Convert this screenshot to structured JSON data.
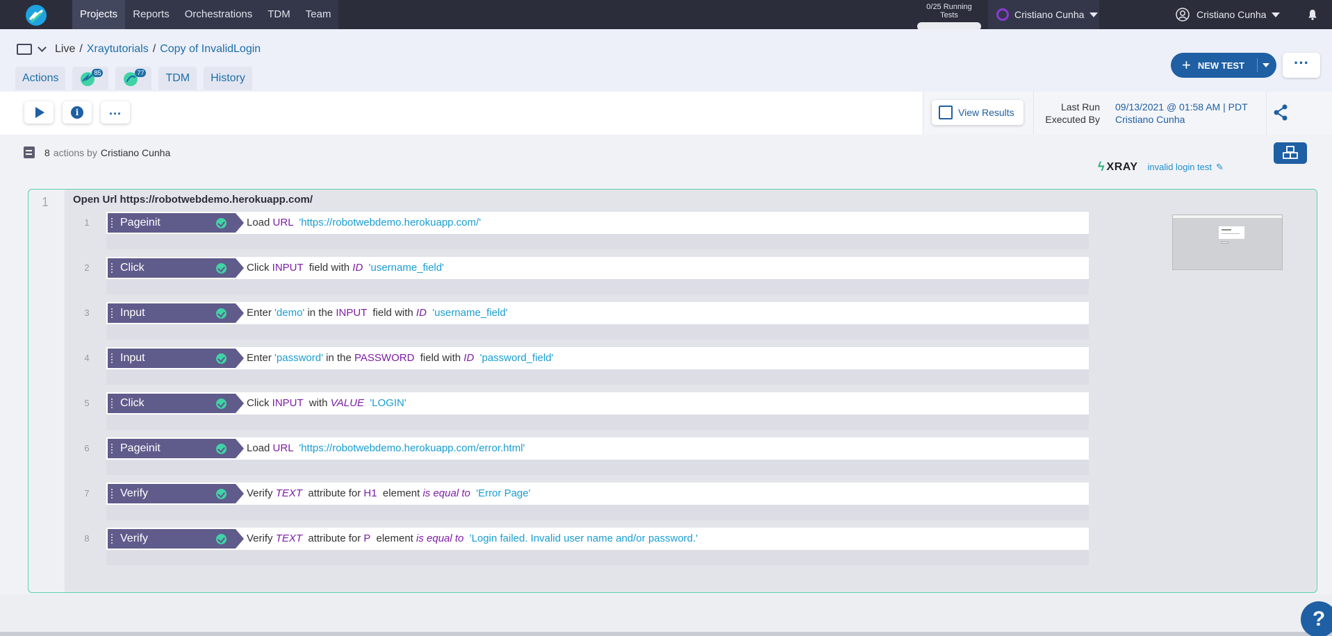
{
  "nav": {
    "items": [
      "Projects",
      "Reports",
      "Orchestrations",
      "TDM",
      "Team"
    ],
    "running_tests": "0/25 Running Tests",
    "org_user": "Cristiano Cunha",
    "account_user": "Cristiano Cunha"
  },
  "breadcrumb": {
    "root": "Live",
    "project": "Xraytutorials",
    "test": "Copy of InvalidLogin"
  },
  "tabs": {
    "actions": "Actions",
    "badge1": "85",
    "badge2": "77",
    "tdm": "TDM",
    "history": "History"
  },
  "header": {
    "new_test": "NEW TEST"
  },
  "run": {
    "view_results": "View Results",
    "last_run_label": "Last Run",
    "executed_by_label": "Executed By",
    "last_run_value": "09/13/2021 @ 01:58 AM | PDT",
    "executed_by_value": "Cristiano Cunha"
  },
  "summary": {
    "count": "8",
    "by_text": "actions by",
    "author": "Cristiano Cunha"
  },
  "xray": {
    "brand": "XRAY",
    "test_name": "invalid login test"
  },
  "panel": {
    "index": "1",
    "title": "Open Url https://robotwebdemo.herokuapp.com/"
  },
  "steps": [
    {
      "n": "1",
      "kw": "Pageinit",
      "desc": [
        [
          "t",
          "Load "
        ],
        [
          "p",
          "URL"
        ],
        [
          "t",
          "  "
        ],
        [
          "v",
          "'https://robotwebdemo.herokuapp.com/'"
        ]
      ]
    },
    {
      "n": "2",
      "kw": "Click",
      "desc": [
        [
          "t",
          "Click "
        ],
        [
          "p",
          "INPUT"
        ],
        [
          "t",
          "  field with "
        ],
        [
          "pi",
          "ID"
        ],
        [
          "t",
          "  "
        ],
        [
          "v",
          "'username_field'"
        ]
      ]
    },
    {
      "n": "3",
      "kw": "Input",
      "desc": [
        [
          "t",
          "Enter "
        ],
        [
          "v",
          "'demo'"
        ],
        [
          "t",
          " in the "
        ],
        [
          "p",
          "INPUT"
        ],
        [
          "t",
          "  field with "
        ],
        [
          "pi",
          "ID"
        ],
        [
          "t",
          "  "
        ],
        [
          "v",
          "'username_field'"
        ]
      ]
    },
    {
      "n": "4",
      "kw": "Input",
      "desc": [
        [
          "t",
          "Enter "
        ],
        [
          "v",
          "'password'"
        ],
        [
          "t",
          " in the "
        ],
        [
          "p",
          "PASSWORD"
        ],
        [
          "t",
          "  field with "
        ],
        [
          "pi",
          "ID"
        ],
        [
          "t",
          "  "
        ],
        [
          "v",
          "'password_field'"
        ]
      ]
    },
    {
      "n": "5",
      "kw": "Click",
      "desc": [
        [
          "t",
          "Click "
        ],
        [
          "p",
          "INPUT"
        ],
        [
          "t",
          "  with "
        ],
        [
          "pi",
          "VALUE"
        ],
        [
          "t",
          "  "
        ],
        [
          "v",
          "'LOGIN'"
        ]
      ]
    },
    {
      "n": "6",
      "kw": "Pageinit",
      "desc": [
        [
          "t",
          "Load "
        ],
        [
          "p",
          "URL"
        ],
        [
          "t",
          "  "
        ],
        [
          "v",
          "'https://robotwebdemo.herokuapp.com/error.html'"
        ]
      ]
    },
    {
      "n": "7",
      "kw": "Verify",
      "desc": [
        [
          "t",
          "Verify "
        ],
        [
          "pi",
          "TEXT"
        ],
        [
          "t",
          "  attribute for "
        ],
        [
          "p",
          "H1"
        ],
        [
          "t",
          "  element "
        ],
        [
          "pi",
          "is equal to"
        ],
        [
          "t",
          "  "
        ],
        [
          "v",
          "'Error Page'"
        ]
      ]
    },
    {
      "n": "8",
      "kw": "Verify",
      "desc": [
        [
          "t",
          "Verify "
        ],
        [
          "pi",
          "TEXT"
        ],
        [
          "t",
          "  attribute for "
        ],
        [
          "p",
          "P"
        ],
        [
          "t",
          "  element "
        ],
        [
          "pi",
          "is equal to"
        ],
        [
          "t",
          "  "
        ],
        [
          "v",
          "'Login failed. Invalid user name and/or password.'"
        ]
      ]
    }
  ],
  "help": "?"
}
